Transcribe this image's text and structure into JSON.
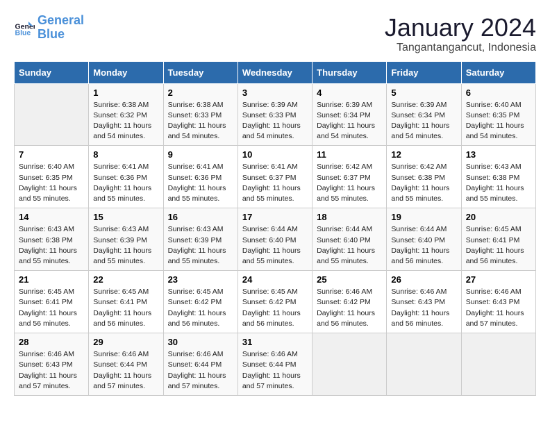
{
  "logo": {
    "text_general": "General",
    "text_blue": "Blue"
  },
  "title": "January 2024",
  "subtitle": "Tangantangancut, Indonesia",
  "days_of_week": [
    "Sunday",
    "Monday",
    "Tuesday",
    "Wednesday",
    "Thursday",
    "Friday",
    "Saturday"
  ],
  "weeks": [
    [
      {
        "day": "",
        "info": ""
      },
      {
        "day": "1",
        "info": "Sunrise: 6:38 AM\nSunset: 6:32 PM\nDaylight: 11 hours\nand 54 minutes."
      },
      {
        "day": "2",
        "info": "Sunrise: 6:38 AM\nSunset: 6:33 PM\nDaylight: 11 hours\nand 54 minutes."
      },
      {
        "day": "3",
        "info": "Sunrise: 6:39 AM\nSunset: 6:33 PM\nDaylight: 11 hours\nand 54 minutes."
      },
      {
        "day": "4",
        "info": "Sunrise: 6:39 AM\nSunset: 6:34 PM\nDaylight: 11 hours\nand 54 minutes."
      },
      {
        "day": "5",
        "info": "Sunrise: 6:39 AM\nSunset: 6:34 PM\nDaylight: 11 hours\nand 54 minutes."
      },
      {
        "day": "6",
        "info": "Sunrise: 6:40 AM\nSunset: 6:35 PM\nDaylight: 11 hours\nand 54 minutes."
      }
    ],
    [
      {
        "day": "7",
        "info": "Sunrise: 6:40 AM\nSunset: 6:35 PM\nDaylight: 11 hours\nand 55 minutes."
      },
      {
        "day": "8",
        "info": "Sunrise: 6:41 AM\nSunset: 6:36 PM\nDaylight: 11 hours\nand 55 minutes."
      },
      {
        "day": "9",
        "info": "Sunrise: 6:41 AM\nSunset: 6:36 PM\nDaylight: 11 hours\nand 55 minutes."
      },
      {
        "day": "10",
        "info": "Sunrise: 6:41 AM\nSunset: 6:37 PM\nDaylight: 11 hours\nand 55 minutes."
      },
      {
        "day": "11",
        "info": "Sunrise: 6:42 AM\nSunset: 6:37 PM\nDaylight: 11 hours\nand 55 minutes."
      },
      {
        "day": "12",
        "info": "Sunrise: 6:42 AM\nSunset: 6:38 PM\nDaylight: 11 hours\nand 55 minutes."
      },
      {
        "day": "13",
        "info": "Sunrise: 6:43 AM\nSunset: 6:38 PM\nDaylight: 11 hours\nand 55 minutes."
      }
    ],
    [
      {
        "day": "14",
        "info": "Sunrise: 6:43 AM\nSunset: 6:38 PM\nDaylight: 11 hours\nand 55 minutes."
      },
      {
        "day": "15",
        "info": "Sunrise: 6:43 AM\nSunset: 6:39 PM\nDaylight: 11 hours\nand 55 minutes."
      },
      {
        "day": "16",
        "info": "Sunrise: 6:43 AM\nSunset: 6:39 PM\nDaylight: 11 hours\nand 55 minutes."
      },
      {
        "day": "17",
        "info": "Sunrise: 6:44 AM\nSunset: 6:40 PM\nDaylight: 11 hours\nand 55 minutes."
      },
      {
        "day": "18",
        "info": "Sunrise: 6:44 AM\nSunset: 6:40 PM\nDaylight: 11 hours\nand 55 minutes."
      },
      {
        "day": "19",
        "info": "Sunrise: 6:44 AM\nSunset: 6:40 PM\nDaylight: 11 hours\nand 56 minutes."
      },
      {
        "day": "20",
        "info": "Sunrise: 6:45 AM\nSunset: 6:41 PM\nDaylight: 11 hours\nand 56 minutes."
      }
    ],
    [
      {
        "day": "21",
        "info": "Sunrise: 6:45 AM\nSunset: 6:41 PM\nDaylight: 11 hours\nand 56 minutes."
      },
      {
        "day": "22",
        "info": "Sunrise: 6:45 AM\nSunset: 6:41 PM\nDaylight: 11 hours\nand 56 minutes."
      },
      {
        "day": "23",
        "info": "Sunrise: 6:45 AM\nSunset: 6:42 PM\nDaylight: 11 hours\nand 56 minutes."
      },
      {
        "day": "24",
        "info": "Sunrise: 6:45 AM\nSunset: 6:42 PM\nDaylight: 11 hours\nand 56 minutes."
      },
      {
        "day": "25",
        "info": "Sunrise: 6:46 AM\nSunset: 6:42 PM\nDaylight: 11 hours\nand 56 minutes."
      },
      {
        "day": "26",
        "info": "Sunrise: 6:46 AM\nSunset: 6:43 PM\nDaylight: 11 hours\nand 56 minutes."
      },
      {
        "day": "27",
        "info": "Sunrise: 6:46 AM\nSunset: 6:43 PM\nDaylight: 11 hours\nand 57 minutes."
      }
    ],
    [
      {
        "day": "28",
        "info": "Sunrise: 6:46 AM\nSunset: 6:43 PM\nDaylight: 11 hours\nand 57 minutes."
      },
      {
        "day": "29",
        "info": "Sunrise: 6:46 AM\nSunset: 6:44 PM\nDaylight: 11 hours\nand 57 minutes."
      },
      {
        "day": "30",
        "info": "Sunrise: 6:46 AM\nSunset: 6:44 PM\nDaylight: 11 hours\nand 57 minutes."
      },
      {
        "day": "31",
        "info": "Sunrise: 6:46 AM\nSunset: 6:44 PM\nDaylight: 11 hours\nand 57 minutes."
      },
      {
        "day": "",
        "info": ""
      },
      {
        "day": "",
        "info": ""
      },
      {
        "day": "",
        "info": ""
      }
    ]
  ]
}
